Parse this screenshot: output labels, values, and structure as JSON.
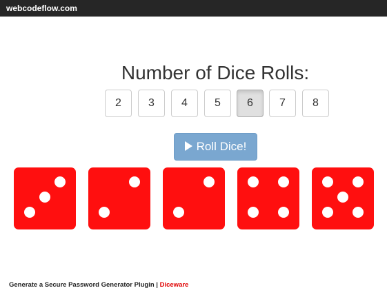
{
  "topbar": {
    "brand": "webcodeflow.com"
  },
  "heading": "Number of Dice Rolls:",
  "choices": [
    {
      "label": "2",
      "active": false
    },
    {
      "label": "3",
      "active": false
    },
    {
      "label": "4",
      "active": false
    },
    {
      "label": "5",
      "active": false
    },
    {
      "label": "6",
      "active": true
    },
    {
      "label": "7",
      "active": false
    },
    {
      "label": "8",
      "active": false
    }
  ],
  "roll_button": {
    "label": "Roll Dice!",
    "icon": "play-icon"
  },
  "dice": [
    {
      "value": 3
    },
    {
      "value": 2
    },
    {
      "value": 2
    },
    {
      "value": 4
    },
    {
      "value": 5
    }
  ],
  "footer": {
    "text": "Generate a Secure Password Generator Plugin | ",
    "link": "Diceware"
  },
  "colors": {
    "topbar": "#262626",
    "die": "#ff0f0f",
    "button": "#7aa7d0",
    "link": "#e00000"
  }
}
